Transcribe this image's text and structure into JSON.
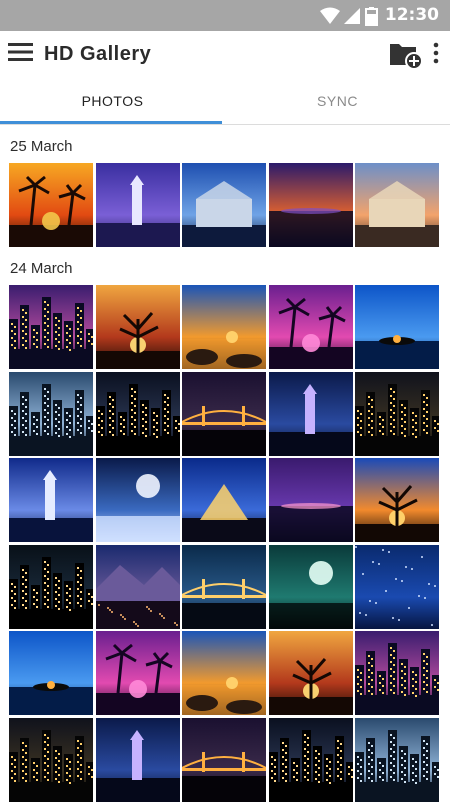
{
  "status_bar": {
    "time": "12:30",
    "icons": [
      "wifi-icon",
      "signal-icon",
      "battery-icon"
    ]
  },
  "app_bar": {
    "title": "HD Gallery",
    "icons": [
      "menu-icon",
      "add-folder-icon",
      "more-vert-icon"
    ]
  },
  "tabs": [
    {
      "label": "PHOTOS",
      "selected": true
    },
    {
      "label": "SYNC",
      "selected": false
    }
  ],
  "sections": [
    {
      "date": "25 March",
      "photos": [
        "sunset-palms",
        "lighthouse",
        "modern-building",
        "sunset-lake-purple",
        "castle-sky"
      ]
    },
    {
      "date": "24 March",
      "photos": [
        "city-skyline-purple",
        "tree-silhouette-sunset",
        "rocky-shore-sunset",
        "pink-palms-reflection",
        "blue-island-sunset",
        "blue-harbor-city",
        "night-bridge-city",
        "golden-bridge-night",
        "night-pavilion-lights",
        "riverside-buildings-night",
        "eiffel-clouds",
        "moon-ice",
        "louvre-pyramid-night",
        "purple-harbor-night",
        "lone-tree-sunset",
        "city-night-lights",
        "mountain-town-dusk",
        "river-bridge-night",
        "moon-lake-trees",
        "starry-blue-sky",
        "blue-island-sunset",
        "pink-palms-reflection",
        "rocky-shore-sunset",
        "tree-silhouette-sunset",
        "city-skyline-purple",
        "riverside-buildings-night",
        "night-pavilion-lights",
        "golden-bridge-night",
        "night-bridge-city",
        "blue-harbor-city"
      ]
    }
  ],
  "colors": {
    "accent": "#3f8fd8",
    "status_bar": "#a6a6a6",
    "tab_inactive": "#8a8a8a"
  }
}
